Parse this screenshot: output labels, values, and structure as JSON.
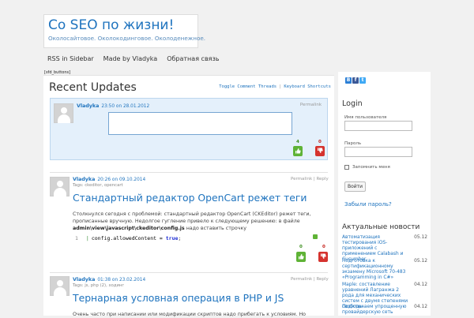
{
  "site": {
    "title": "Co SEO по жизни!",
    "description": "Околосайтовое. Околокодинговое. Околоденежное."
  },
  "nav": {
    "items": [
      "RSS in Sidebar",
      "Made by Vladyka",
      "Обратная связь"
    ]
  },
  "sfd_label": "[sfd_buttons]",
  "main": {
    "title": "Recent Updates",
    "links": {
      "toggle": "Toggle Comment Threads",
      "separator": "|",
      "shortcuts": "Keyboard Shortcuts"
    }
  },
  "compose": {
    "author": "Vladyka",
    "time": "23:50 on 28.01.2012",
    "permalink": "Permalink",
    "votes": {
      "up": "4",
      "down": "0"
    }
  },
  "posts": [
    {
      "author": "Vladyka",
      "time": "20:26 on 09.10.2014",
      "tags_label": "Tags:",
      "tags": "ckeditor, opencart",
      "permalink": "Permalink | Reply",
      "title": "Стандартный редактор OpenCart режет теги",
      "text_1": "Столкнулся сегодня с проблемой: стандартный редактор OpenCart (CKEditor) режет теги,",
      "text_2": "прописанные вручную. Недолгое гугление привело к следующему решению: в файле",
      "text_3_bold": "admin\\view\\javascript\\ckeditor\\config.js",
      "text_3_rest": " надо вставить строчку",
      "code_line_no": "1",
      "code_text": "config.allowedContent = ",
      "code_value": "true",
      "code_end": ";",
      "votes": {
        "up": "0",
        "down": "0"
      }
    },
    {
      "author": "Vladyka",
      "time": "01:38 on 23.02.2014",
      "tags_label": "Tags:",
      "tags": "js, php (2), ходинг",
      "permalink": "Permalink | Reply",
      "title": "Тернарная условная операция в PHP и JS",
      "text_1": "Очень часто при написании или модификации скриптов надо прибегать к условиям. Но"
    }
  ],
  "sidebar": {
    "social": [
      "B",
      "f",
      "t"
    ],
    "login": {
      "title": "Login",
      "username_label": "Имя пользователя",
      "password_label": "Пароль",
      "remember_label": "Запомнить меня",
      "button": "Войти",
      "lost_password": "Забыли пароль?"
    },
    "news": {
      "title": "Актуальные новости",
      "items": [
        {
          "title": "Автоматизация тестирования iOS-приложений с применением Calabash и Cucumber",
          "date": "05.12"
        },
        {
          "title": "Подготовка к сертификационному экзамену Microsoft 70-483 «Programming in C#»",
          "date": "05.12"
        },
        {
          "title": "Maple: составление уравнений Лагранжа 2 рода для механических систем с двумя степенями свободы",
          "date": "04.12"
        },
        {
          "title": "Подключаем упрощенную провайдерскую сеть",
          "date": "04.12"
        }
      ]
    }
  },
  "colors": {
    "accent": "#1e73be",
    "compose_bg": "#e4f0fb",
    "vote_up": "#5fb336",
    "vote_down": "#d5332e"
  }
}
